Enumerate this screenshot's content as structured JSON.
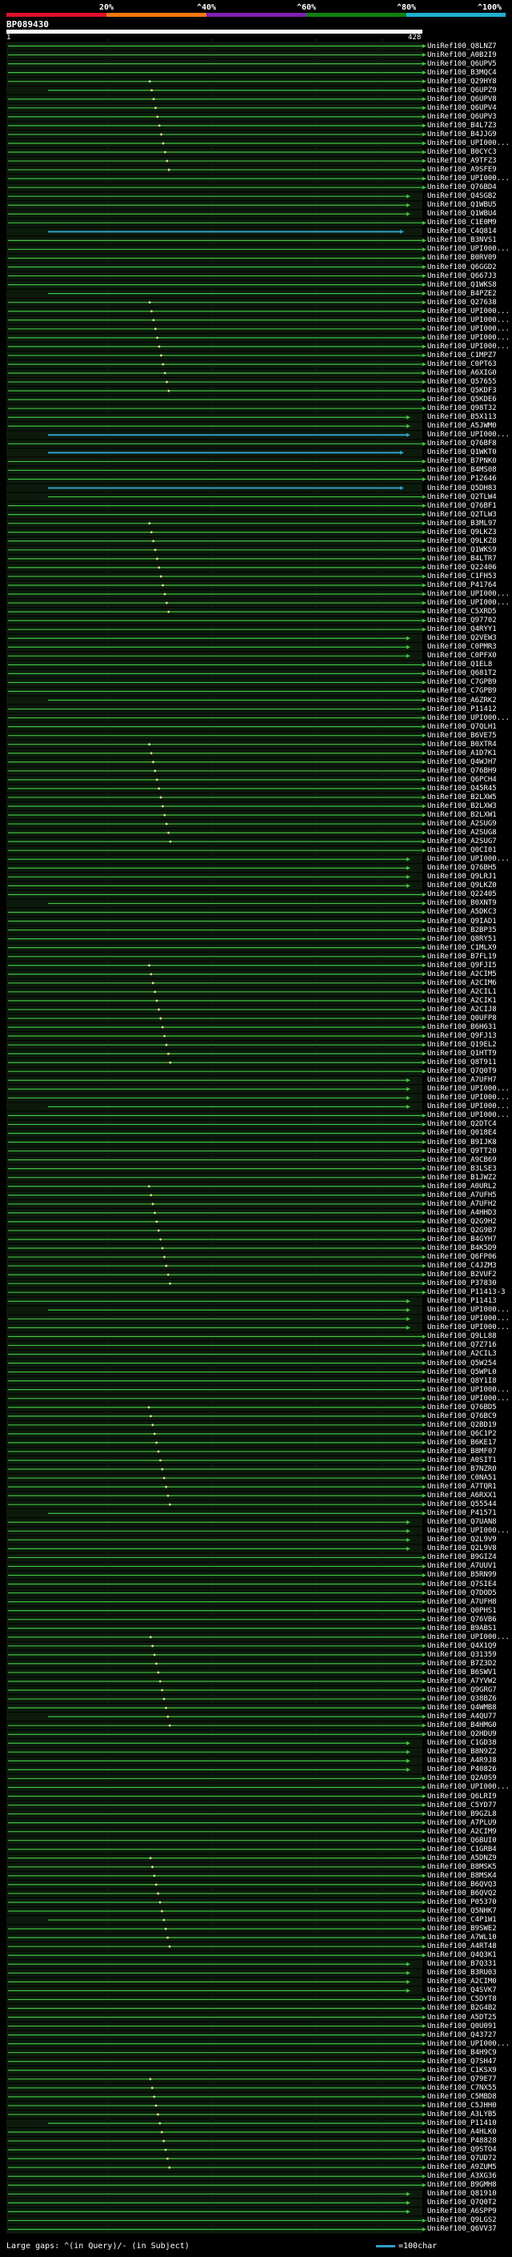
{
  "scale": {
    "ticks": [
      "20%",
      "^40%",
      "^60%",
      "^80%",
      "^100%"
    ],
    "band_colors": [
      "#e0102a",
      "#f07810",
      "#8020b0",
      "#108010",
      "#20b0d0"
    ]
  },
  "query": {
    "id": "BP089430",
    "start_label": "1",
    "end_label": "428"
  },
  "colors": {
    "hit_line": "#3ec23e",
    "hit_frame": "#1a5a1a",
    "long_hit": "#2fa0c8",
    "gap_mark": "#f0e08a",
    "shade": "#0c1a0c"
  },
  "hits": [
    "UniRef100_Q8LNZ7",
    "UniRef100_A0B2I9",
    "UniRef100_Q6UPV5",
    "UniRef100_B3MQC4",
    "UniRef100_Q29HY8",
    "UniRef100_Q6UPZ9",
    "UniRef100_Q6UPV8",
    "UniRef100_Q6UPV4",
    "UniRef100_Q6UPV3",
    "UniRef100_B4L7Z3",
    "UniRef100_B4JJG9",
    "UniRef100_UPI000...",
    "UniRef100_B0CYC3",
    "UniRef100_A9TFZ3",
    "UniRef100_A9SFE9",
    "UniRef100_UPI000...",
    "UniRef100_Q76BD4",
    "UniRef100_Q4SGB2",
    "UniRef100_Q1WBU5",
    "UniRef100_Q1WBU4",
    "UniRef100_C1E0M9",
    "UniRef100_C4Q814",
    "UniRef100_B3NVS1",
    "UniRef100_UPI000...",
    "UniRef100_B0RV09",
    "UniRef100_Q6GGD2",
    "UniRef100_Q667J3",
    "UniRef100_Q1WKS8",
    "UniRef100_B4PZE2",
    "UniRef100_Q27638",
    "UniRef100_UPI000...",
    "UniRef100_UPI000...",
    "UniRef100_UPI000...",
    "UniRef100_UPI000...",
    "UniRef100_UPI000...",
    "UniRef100_C1MPZ7",
    "UniRef100_C0PT63",
    "UniRef100_A6XIG0",
    "UniRef100_Q57655",
    "UniRef100_Q5KDF3",
    "UniRef100_Q5KDE6",
    "UniRef100_Q98T32",
    "UniRef100_B5X113",
    "UniRef100_A5JWM0",
    "UniRef100_UPI000...",
    "UniRef100_Q76BF8",
    "UniRef100_Q1WKT0",
    "UniRef100_B7PNK0",
    "UniRef100_B4MS08",
    "UniRef100_P12646",
    "UniRef100_Q5DH83",
    "UniRef100_Q2TLW4",
    "UniRef100_Q76BF1",
    "UniRef100_Q2TLW3",
    "UniRef100_B3ML97",
    "UniRef100_Q9LKZ3",
    "UniRef100_Q9LKZ8",
    "UniRef100_Q1WKS9",
    "UniRef100_B4LTR7",
    "UniRef100_Q22406",
    "UniRef100_C1FH53",
    "UniRef100_P41764",
    "UniRef100_UPI000...",
    "UniRef100_UPI000...",
    "UniRef100_C5XRD5",
    "UniRef100_Q97702",
    "UniRef100_Q4RYY1",
    "UniRef100_Q2VEW3",
    "UniRef100_C0PMR3",
    "UniRef100_C0PFX0",
    "UniRef100_Q1EL8",
    "UniRef100_Q681T2",
    "UniRef100_C7GPB9",
    "UniRef100_C7GPB9",
    "UniRef100_A6ZRK2",
    "UniRef100_P11412",
    "UniRef100_UPI000...",
    "UniRef100_Q7QLH1",
    "UniRef100_B6VE75",
    "UniRef100_B0XTR4",
    "UniRef100_A1D7K1",
    "UniRef100_Q4WJH7",
    "UniRef100_Q76BH9",
    "UniRef100_Q6PCH4",
    "UniRef100_Q45R45",
    "UniRef100_B2LXW5",
    "UniRef100_B2LXW3",
    "UniRef100_B2LXW1",
    "UniRef100_A2SUG9",
    "UniRef100_A2SUG8",
    "UniRef100_A2SUG7",
    "UniRef100_Q0CI01",
    "UniRef100_UPI000...",
    "UniRef100_Q76BH5",
    "UniRef100_Q9LRJ1",
    "UniRef100_Q9LKZ0",
    "UniRef100_Q22405",
    "UniRef100_B0XNT9",
    "UniRef100_A5DKC3",
    "UniRef100_Q9IAD1",
    "UniRef100_B2BP35",
    "UniRef100_Q8RY51",
    "UniRef100_C1MLX9",
    "UniRef100_B7FL19",
    "UniRef100_Q9FJI5",
    "UniRef100_A2CIM5",
    "UniRef100_A2CIM6",
    "UniRef100_A2CIL1",
    "UniRef100_A2CIK1",
    "UniRef100_A2CIJ8",
    "UniRef100_Q0UFP8",
    "UniRef100_B6H631",
    "UniRef100_Q9FJ13",
    "UniRef100_Q19EL2",
    "UniRef100_Q1HTT9",
    "UniRef100_Q8T911",
    "UniRef100_Q7Q0T9",
    "UniRef100_A7UFH7",
    "UniRef100_UPI000...",
    "UniRef100_UPI000...",
    "UniRef100_UPI000...",
    "UniRef100_UPI000...",
    "UniRef100_Q2DTC4",
    "UniRef100_Q018E4",
    "UniRef100_B9IJK8",
    "UniRef100_Q9TT20",
    "UniRef100_A9CB69",
    "UniRef100_B3LSE3",
    "UniRef100_B1JWZ2",
    "UniRef100_A0URL2",
    "UniRef100_A7UFH5",
    "UniRef100_A7UFH2",
    "UniRef100_A4HHD3",
    "UniRef100_Q2G9H2",
    "UniRef100_Q2G9B7",
    "UniRef100_B4GYH7",
    "UniRef100_B4K5D9",
    "UniRef100_Q6FP06",
    "UniRef100_C4JZM3",
    "UniRef100_B2VUF2",
    "UniRef100_P37830",
    "UniRef100_P11413-3",
    "UniRef100_P11413",
    "UniRef100_UPI000...",
    "UniRef100_UPI000...",
    "UniRef100_UPI000...",
    "UniRef100_Q9LL88",
    "UniRef100_Q7Z716",
    "UniRef100_A2CIL3",
    "UniRef100_Q5W254",
    "UniRef100_Q5WPL0",
    "UniRef100_Q8Y1I8",
    "UniRef100_UPI000...",
    "UniRef100_UPI000...",
    "UniRef100_Q76BD5",
    "UniRef100_Q76BC9",
    "UniRef100_Q2BD19",
    "UniRef100_Q6C1P2",
    "UniRef100_B6KE17",
    "UniRef100_B8MF07",
    "UniRef100_A0SIT1",
    "UniRef100_B7NZR0",
    "UniRef100_C0NA51",
    "UniRef100_A7TQR1",
    "UniRef100_A6RXX1",
    "UniRef100_Q55544",
    "UniRef100_P41571",
    "UniRef100_Q7UAN8",
    "UniRef100_UPI000...",
    "UniRef100_Q2L9V9",
    "UniRef100_Q2L9V8",
    "UniRef100_B9GIZ4",
    "UniRef100_A7UUV1",
    "UniRef100_B5RN99",
    "UniRef100_Q7SIE4",
    "UniRef100_Q7DOD5",
    "UniRef100_A7UFH8",
    "UniRef100_Q0PHS1",
    "UniRef100_Q76VB6",
    "UniRef100_B9ABS1",
    "UniRef100_UPI000...",
    "UniRef100_Q4X1Q9",
    "UniRef100_Q31359",
    "UniRef100_B7Z3D2",
    "UniRef100_B6SWV1",
    "UniRef100_A7YVW2",
    "UniRef100_Q9GRG7",
    "UniRef100_Q38BZ6",
    "UniRef100_Q4WMB8",
    "UniRef100_A4QU77",
    "UniRef100_B4HMG0",
    "UniRef100_Q2HDU9",
    "UniRef100_C1GD38",
    "UniRef100_B8N9Z2",
    "UniRef100_A4R9J8",
    "UniRef100_P40826",
    "UniRef100_Q2A0S9",
    "UniRef100_UPI000...",
    "UniRef100_Q6LRI9",
    "UniRef100_C5YD77",
    "UniRef100_B9GZL8",
    "UniRef100_A7PLU9",
    "UniRef100_A2CIM9",
    "UniRef100_Q6BUI0",
    "UniRef100_C1GRB4",
    "UniRef100_A5DNZ9",
    "UniRef100_B8MSK5",
    "UniRef100_B8MSK4",
    "UniRef100_B6QVQ3",
    "UniRef100_B6QVQ2",
    "UniRef100_P05370",
    "UniRef100_Q5NHK7",
    "UniRef100_C4P1W1",
    "UniRef100_B9SWE2",
    "UniRef100_A7WL10",
    "UniRef100_A4RT48",
    "UniRef100_Q4Q3K1",
    "UniRef100_B7Q331",
    "UniRef100_B3RU03",
    "UniRef100_A2CIM0",
    "UniRef100_Q4SVK7",
    "UniRef100_C5DYT8",
    "UniRef100_B2G4B2",
    "UniRef100_A5DT25",
    "UniRef100_Q0U091",
    "UniRef100_Q43727",
    "UniRef100_UPI000...",
    "UniRef100_B4H9C9",
    "UniRef100_Q7SH47",
    "UniRef100_C1KSX9",
    "UniRef100_Q79E77",
    "UniRef100_C7NX55",
    "UniRef100_C5MBD8",
    "UniRef100_C5JHH0",
    "UniRef100_A3LYB5",
    "UniRef100_P11410",
    "UniRef100_A4HLK0",
    "UniRef100_P48828",
    "UniRef100_Q9STO4",
    "UniRef100_Q7UD72",
    "UniRef100_A9ZUM5",
    "UniRef100_A3XG36",
    "UniRef100_B9GMH8",
    "UniRef100_Q81910",
    "UniRef100_Q7Q0T2",
    "UniRef100_A6SPP9",
    "UniRef100_Q9LGS2",
    "UniRef100_Q6VV37"
  ],
  "legend": {
    "left": "Large gaps: ^(in Query)/- (in Subject)",
    "right": "=100char"
  }
}
